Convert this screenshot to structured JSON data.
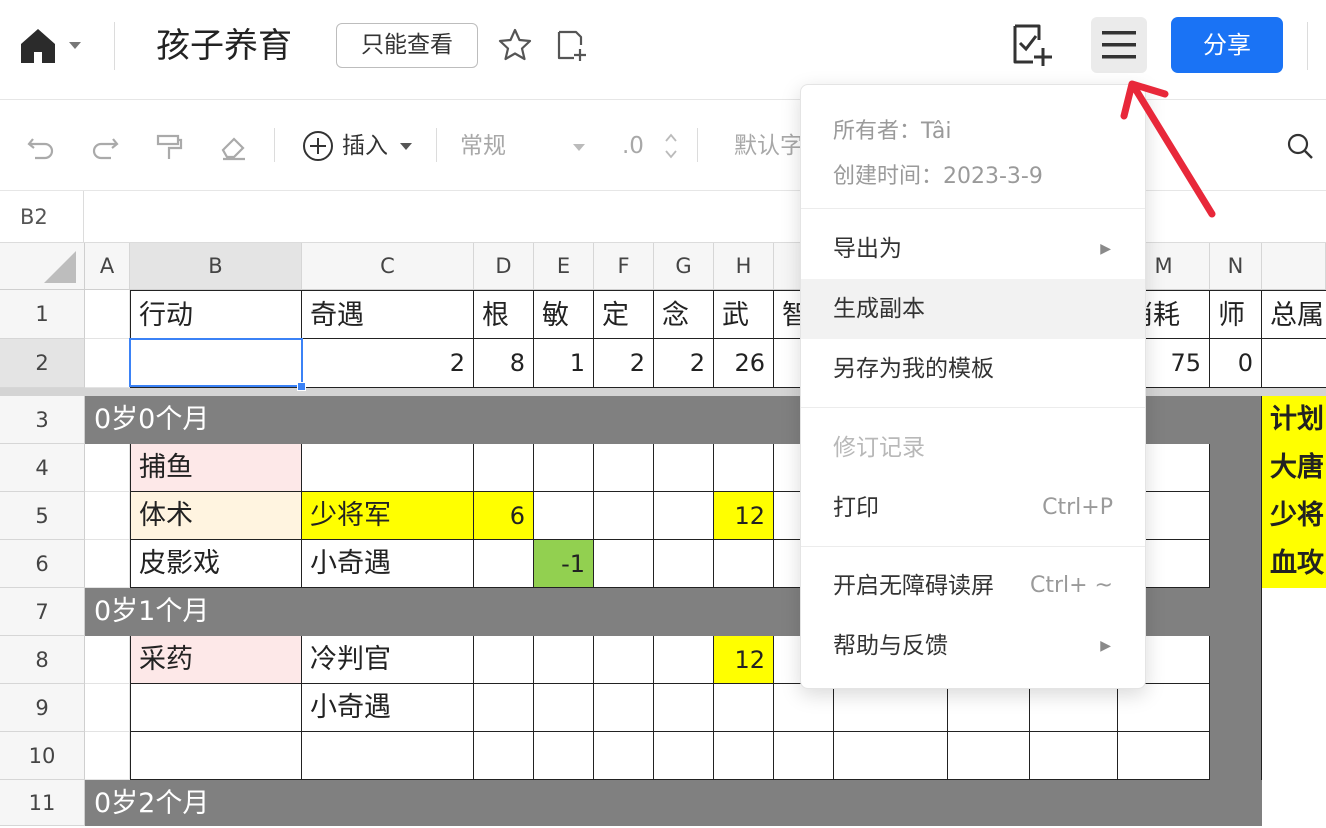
{
  "header": {
    "title": "孩子养育",
    "readonly_badge": "只能查看",
    "share_label": "分享"
  },
  "toolbar": {
    "insert_label": "插入",
    "format_label": "常规",
    "decimal_label": ".0",
    "font_label": "默认字"
  },
  "formula": {
    "cell_ref": "B2"
  },
  "grid": {
    "columns": [
      "A",
      "B",
      "C",
      "D",
      "E",
      "F",
      "G",
      "H",
      "M",
      "N"
    ],
    "rows": [
      "1",
      "2",
      "3",
      "4",
      "5",
      "6",
      "7",
      "8",
      "9",
      "10",
      "11"
    ],
    "row1": {
      "b": "行动",
      "c": "奇遇",
      "d": "根",
      "e": "敏",
      "f": "定",
      "g": "念",
      "h": "武",
      "i": "智",
      "m": "消耗",
      "n": "师",
      "o": "总属"
    },
    "row2": {
      "c": "2",
      "d": "8",
      "e": "1",
      "f": "2",
      "g": "2",
      "h": "26",
      "m": "75",
      "n": "0"
    },
    "band_rows": {
      "r3": "0岁0个月",
      "r7": "0岁1个月",
      "r11": "0岁2个月"
    },
    "row4": {
      "b": "捕鱼"
    },
    "row5": {
      "b": "体术",
      "c": "少将军",
      "d": "6",
      "h": "12"
    },
    "row6": {
      "b": "皮影戏",
      "c": "小奇遇",
      "e": "-1"
    },
    "row8": {
      "b": "采药",
      "c": "冷判官",
      "h": "12"
    },
    "row9": {
      "c": "小奇遇"
    },
    "side_notes": [
      "计划",
      "大唐",
      "少将",
      "血攻"
    ]
  },
  "menu": {
    "owner": "所有者：Tâi",
    "created": "创建时间：2023-3-9",
    "export": "导出为",
    "copy": "生成副本",
    "save_template": "另存为我的模板",
    "history": "修订记录",
    "print": "打印",
    "print_shortcut": "Ctrl+P",
    "accessibility": "开启无障碍读屏",
    "accessibility_shortcut": "Ctrl+ ~",
    "help": "帮助与反馈"
  },
  "colors": {
    "accent": "#1a73f5",
    "highlight": "#ffff00",
    "band": "#808080",
    "green_cell": "#92d050",
    "annotation_arrow": "#e8283a"
  }
}
